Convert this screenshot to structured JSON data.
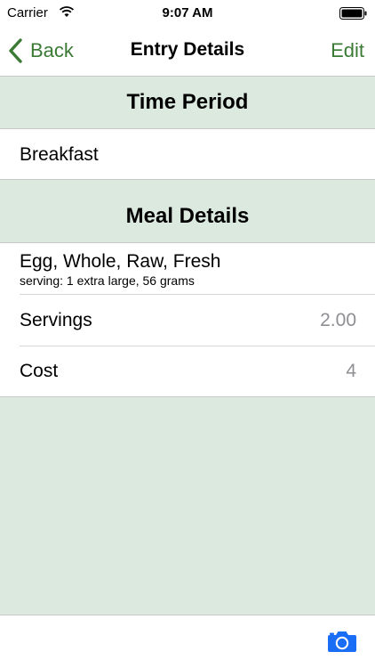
{
  "status_bar": {
    "carrier": "Carrier",
    "time": "9:07 AM",
    "icons": [
      "wifi-icon",
      "battery-icon"
    ]
  },
  "nav": {
    "back_label": "Back",
    "title": "Entry Details",
    "edit_label": "Edit"
  },
  "sections": {
    "time_period": {
      "header": "Time Period",
      "value": "Breakfast"
    },
    "meal_details": {
      "header": "Meal Details",
      "food_name": "Egg, Whole, Raw, Fresh",
      "food_serving": "serving: 1 extra large, 56 grams",
      "servings_label": "Servings",
      "servings_value": "2.00",
      "cost_label": "Cost",
      "cost_value": "4"
    }
  },
  "toolbar": {
    "icons": [
      "camera-icon"
    ]
  },
  "colors": {
    "accent": "#3a7a35",
    "section_background": "#dce9df",
    "camera": "#1a6ef5",
    "secondary_text": "#8e8e93"
  }
}
